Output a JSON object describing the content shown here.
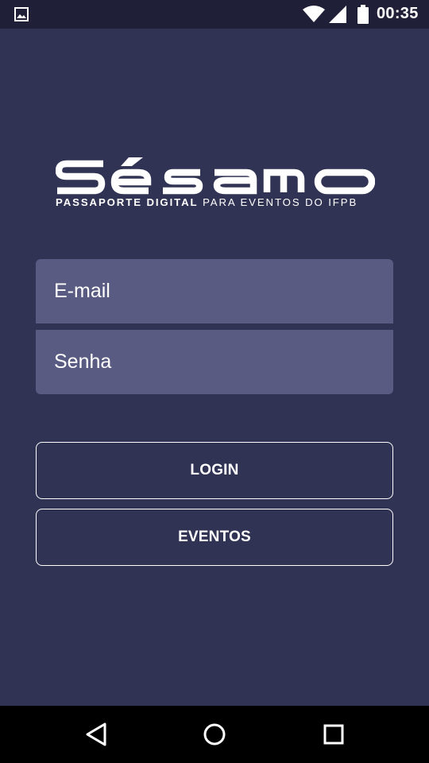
{
  "status_bar": {
    "time": "00:35",
    "icons": [
      "gallery-icon",
      "wifi-icon",
      "signal-icon",
      "battery-icon"
    ]
  },
  "logo": {
    "wordmark": "Sésamo",
    "tagline_bold": "PASSAPORTE DIGITAL",
    "tagline_rest": " PARA EVENTOS DO IFPB"
  },
  "form": {
    "email_placeholder": "E-mail",
    "email_value": "",
    "password_placeholder": "Senha",
    "password_value": ""
  },
  "buttons": {
    "login_label": "LOGIN",
    "eventos_label": "EVENTOS"
  },
  "nav_bar": {
    "icons": [
      "back-icon",
      "home-icon",
      "recents-icon"
    ]
  },
  "colors": {
    "background": "#313354",
    "status_bar": "#1f2038",
    "field": "#5a5b82",
    "text": "#ffffff",
    "nav_bar": "#000000"
  }
}
